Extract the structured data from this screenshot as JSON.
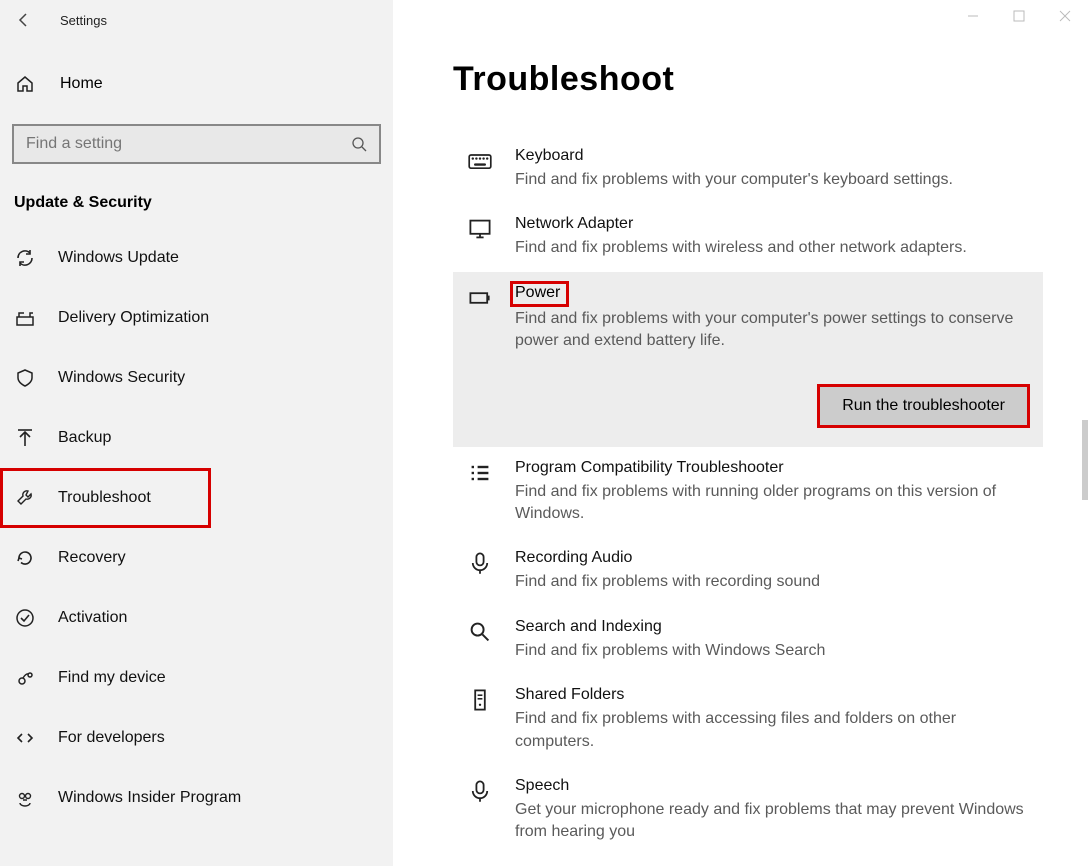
{
  "window": {
    "title": "Settings"
  },
  "sidebar": {
    "home_label": "Home",
    "search_placeholder": "Find a setting",
    "category": "Update & Security",
    "items": [
      {
        "label": "Windows Update",
        "icon": "sync"
      },
      {
        "label": "Delivery Optimization",
        "icon": "delivery"
      },
      {
        "label": "Windows Security",
        "icon": "shield"
      },
      {
        "label": "Backup",
        "icon": "backup"
      },
      {
        "label": "Troubleshoot",
        "icon": "wrench",
        "highlighted": true
      },
      {
        "label": "Recovery",
        "icon": "recovery"
      },
      {
        "label": "Activation",
        "icon": "check"
      },
      {
        "label": "Find my device",
        "icon": "finddevice"
      },
      {
        "label": "For developers",
        "icon": "devs"
      },
      {
        "label": "Windows Insider Program",
        "icon": "insider"
      }
    ]
  },
  "main": {
    "title": "Troubleshoot",
    "run_button_label": "Run the troubleshooter",
    "selected_index": 2,
    "items": [
      {
        "name": "Keyboard",
        "desc": "Find and fix problems with your computer's keyboard settings.",
        "icon": "keyboard"
      },
      {
        "name": "Network Adapter",
        "desc": "Find and fix problems with wireless and other network adapters.",
        "icon": "monitor"
      },
      {
        "name": "Power",
        "desc": "Find and fix problems with your computer's power settings to conserve power and extend battery life.",
        "icon": "battery",
        "expanded": true,
        "name_highlighted": true
      },
      {
        "name": "Program Compatibility Troubleshooter",
        "desc": "Find and fix problems with running older programs on this version of Windows.",
        "icon": "list"
      },
      {
        "name": "Recording Audio",
        "desc": "Find and fix problems with recording sound",
        "icon": "mic"
      },
      {
        "name": "Search and Indexing",
        "desc": "Find and fix problems with Windows Search",
        "icon": "search"
      },
      {
        "name": "Shared Folders",
        "desc": "Find and fix problems with accessing files and folders on other computers.",
        "icon": "server"
      },
      {
        "name": "Speech",
        "desc": "Get your microphone ready and fix problems that may prevent Windows from hearing you",
        "icon": "mic"
      }
    ]
  }
}
